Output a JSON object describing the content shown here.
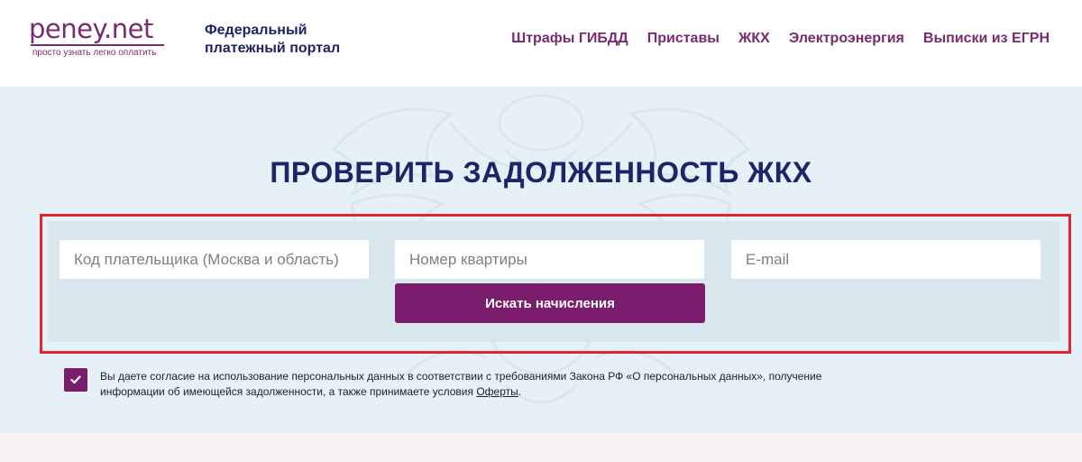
{
  "header": {
    "logo_text": "peney.net",
    "logo_tagline": "просто узнать легко оплатить",
    "portal_name": "Федеральный платежный портал",
    "nav": [
      {
        "label": "Штрафы ГИБДД"
      },
      {
        "label": "Приставы"
      },
      {
        "label": "ЖКХ"
      },
      {
        "label": "Электроэнергия"
      },
      {
        "label": "Выписки из ЕГРН"
      }
    ]
  },
  "hero": {
    "title": "ПРОВЕРИТЬ ЗАДОЛЖЕННОСТЬ ЖКХ",
    "form": {
      "payer_code": {
        "value": "",
        "placeholder": "Код плательщика (Москва и область)"
      },
      "apartment": {
        "value": "",
        "placeholder": "Номер квартиры"
      },
      "email": {
        "value": "",
        "placeholder": "E-mail"
      },
      "submit_label": "Искать начисления"
    },
    "consent": {
      "checked": true,
      "text": "Вы даете согласие на использование персональных данных в соответствии с требованиями Закона РФ «О персональных данных», получение информации об имеющейся задолженности, а также принимаете условия ",
      "link_label": "Оферты",
      "suffix": "."
    }
  },
  "colors": {
    "brand_purple": "#7a1d6c",
    "navy": "#1e2466",
    "hero_bg": "#e6f1f7",
    "highlight_red": "#e0262f"
  },
  "icons": {
    "checkbox": "check-icon",
    "watermark": "emblem-watermark-icon"
  }
}
